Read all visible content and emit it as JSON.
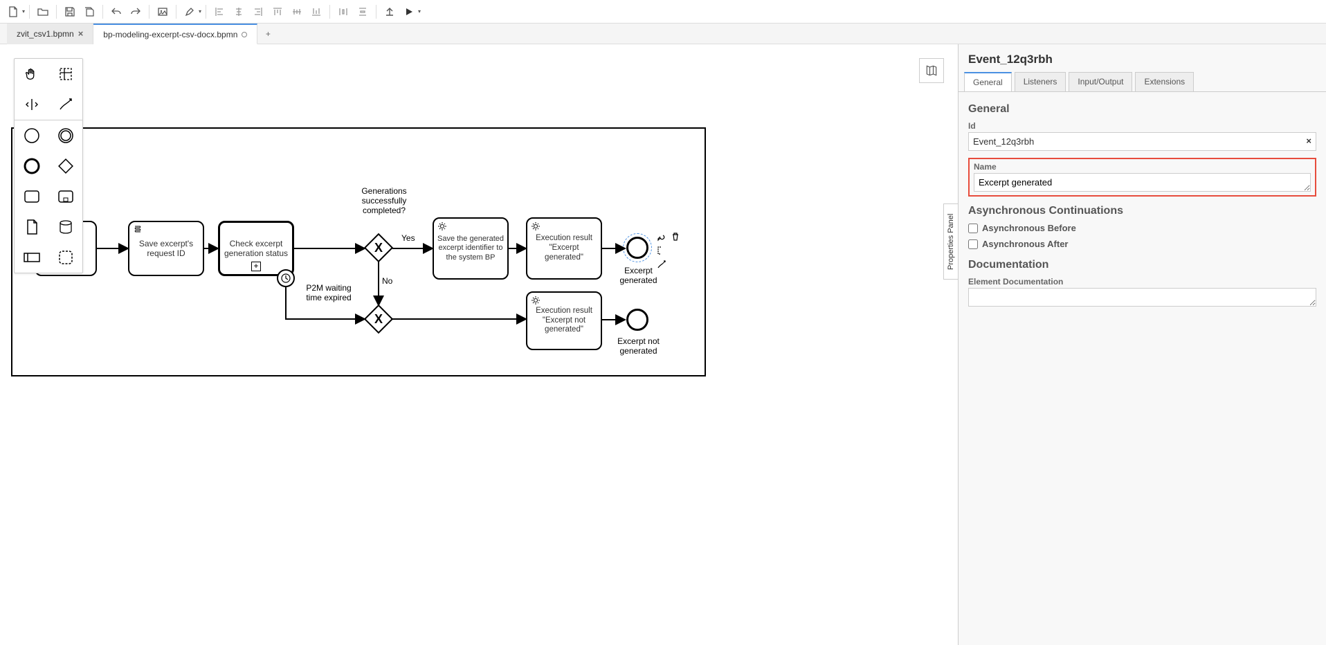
{
  "toolbar": {
    "spacer": ""
  },
  "tabs": {
    "items": [
      {
        "label": "zvit_csv1.bpmn",
        "closable": true,
        "active": false
      },
      {
        "label": "bp-modeling-excerpt-csv-docx.bpmn",
        "dirty": true,
        "active": true
      }
    ]
  },
  "diagram": {
    "task_save_request": "Save excerpt's request ID",
    "task_check_status": "Check excerpt generation status",
    "timer_label": "P2M waiting time expired",
    "gateway_label": "Generations successfully completed?",
    "gw_yes": "Yes",
    "gw_no": "No",
    "task_save_identifier": "Save the generated excerpt identifier to the system BP",
    "task_exec_ok": "Execution result \"Excerpt generated\"",
    "task_exec_fail": "Execution result \"Excerpt not generated\"",
    "end_ok": "Excerpt generated",
    "end_fail": "Excerpt not generated"
  },
  "panel": {
    "toggle": "Properties Panel",
    "title": "Event_12q3rbh",
    "tabs": [
      "General",
      "Listeners",
      "Input/Output",
      "Extensions"
    ],
    "section_general": "General",
    "id_label": "Id",
    "id_value": "Event_12q3rbh",
    "name_label": "Name",
    "name_value": "Excerpt generated",
    "section_async": "Asynchronous Continuations",
    "async_before": "Asynchronous Before",
    "async_after": "Asynchronous After",
    "section_doc": "Documentation",
    "doc_label": "Element Documentation"
  }
}
